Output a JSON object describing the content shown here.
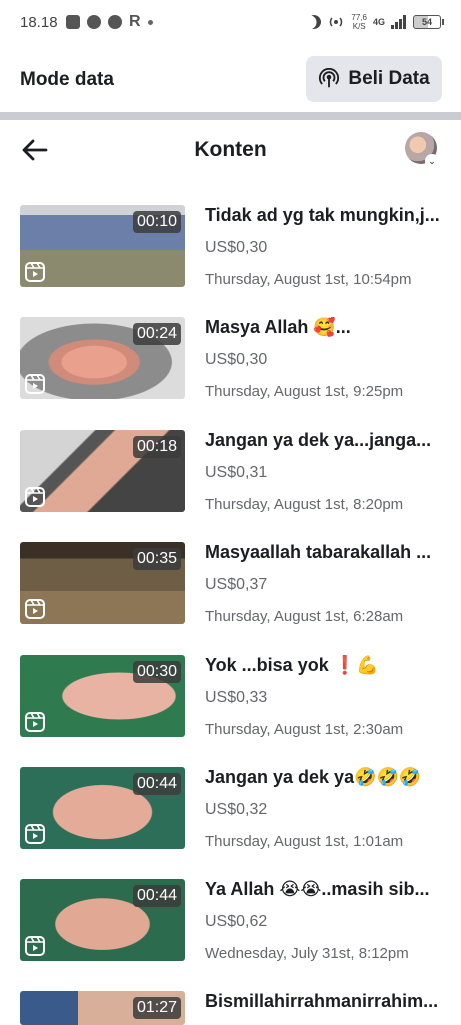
{
  "status_bar": {
    "time": "18.18",
    "net_speed_value": "77,6",
    "net_speed_unit": "K/S",
    "network": "4G",
    "battery": "54"
  },
  "data_banner": {
    "mode_label": "Mode data",
    "buy_label": "Beli Data"
  },
  "header": {
    "title": "Konten"
  },
  "items": [
    {
      "title": "Tidak ad yg tak mungkin,j...",
      "earnings": "US$0,30",
      "date": "Thursday, August 1st, 10:54pm",
      "duration": "00:10"
    },
    {
      "title": "Masya Allah 🥰...",
      "earnings": "US$0,30",
      "date": "Thursday, August 1st, 9:25pm",
      "duration": "00:24"
    },
    {
      "title": "Jangan ya dek ya...janga...",
      "earnings": "US$0,31",
      "date": "Thursday, August 1st, 8:20pm",
      "duration": "00:18"
    },
    {
      "title": "Masyaallah tabarakallah ...",
      "earnings": "US$0,37",
      "date": "Thursday, August 1st, 6:28am",
      "duration": "00:35"
    },
    {
      "title": "Yok ...bisa yok ❗💪",
      "earnings": "US$0,33",
      "date": "Thursday, August 1st, 2:30am",
      "duration": "00:30"
    },
    {
      "title": "Jangan ya dek ya🤣🤣🤣",
      "earnings": "US$0,32",
      "date": "Thursday, August 1st, 1:01am",
      "duration": "00:44"
    },
    {
      "title": "Ya Allah 😭😭..masih sib...",
      "earnings": "US$0,62",
      "date": "Wednesday, July 31st, 8:12pm",
      "duration": "00:44"
    },
    {
      "title": "Bismillahirrahmanirrahim...",
      "earnings": "",
      "date": "",
      "duration": "01:27"
    }
  ]
}
